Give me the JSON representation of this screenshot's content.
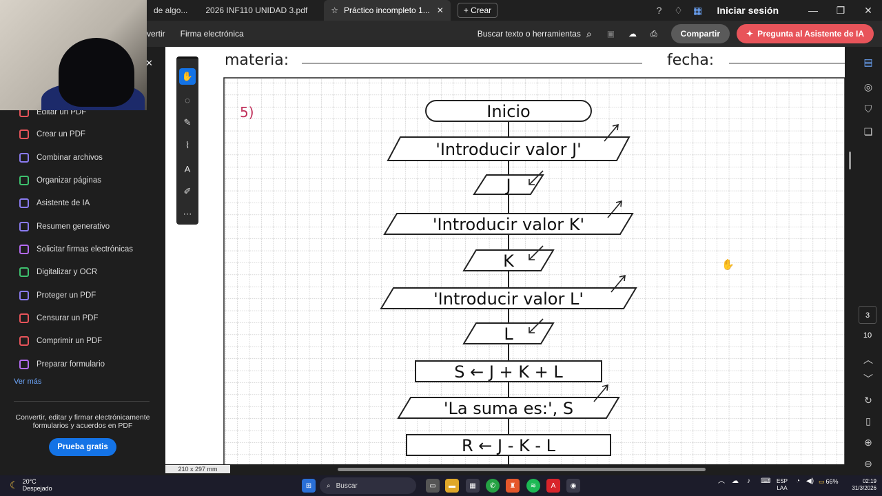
{
  "tabs": [
    {
      "label": "de algo...",
      "active": false
    },
    {
      "label": "2026 INF110 UNIDAD 3.pdf",
      "active": false
    },
    {
      "label": "Práctico incompleto 1...",
      "active": true
    }
  ],
  "new_tab_label": "Crear",
  "login_label": "Iniciar sesión",
  "toolbar": {
    "convert": "vertir",
    "esign": "Firma electrónica",
    "search_tools": "Buscar texto o herramientas",
    "share": "Compartir",
    "ai_ask": "Pregunta al Asistente de IA"
  },
  "sidebar": {
    "items": [
      {
        "label": "Editar un PDF",
        "color": "#e8545a"
      },
      {
        "label": "Crear un PDF",
        "color": "#e8545a"
      },
      {
        "label": "Combinar archivos",
        "color": "#8a7bf0"
      },
      {
        "label": "Organizar páginas",
        "color": "#3ec16e"
      },
      {
        "label": "Asistente de IA",
        "color": "#8a7bf0"
      },
      {
        "label": "Resumen generativo",
        "color": "#8a7bf0"
      },
      {
        "label": "Solicitar firmas electrónicas",
        "color": "#b36af0"
      },
      {
        "label": "Digitalizar y OCR",
        "color": "#3ec16e"
      },
      {
        "label": "Proteger un PDF",
        "color": "#8a7bf0"
      },
      {
        "label": "Censurar un PDF",
        "color": "#e8545a"
      },
      {
        "label": "Comprimir un PDF",
        "color": "#e8545a"
      },
      {
        "label": "Preparar formulario",
        "color": "#b36af0"
      }
    ],
    "see_more": "Ver más",
    "promo": "Convertir, editar y firmar electrónicamente formularios y acuerdos en PDF",
    "trial_button": "Prueba gratis"
  },
  "page_indicator": {
    "current": "3",
    "total": "10"
  },
  "page_size_label": "210 x 297 mm",
  "document": {
    "materia_label": "materia:",
    "fecha_label": "fecha:",
    "exercise_number": "5)",
    "flowchart": [
      {
        "shape": "terminal",
        "text": "Inicio"
      },
      {
        "shape": "output",
        "text": "'Introducir valor J'"
      },
      {
        "shape": "input",
        "text": "J"
      },
      {
        "shape": "output",
        "text": "'Introducir valor K'"
      },
      {
        "shape": "input",
        "text": "K"
      },
      {
        "shape": "output",
        "text": "'Introducir valor L'"
      },
      {
        "shape": "input",
        "text": "L"
      },
      {
        "shape": "process",
        "text": "S ← J + K + L"
      },
      {
        "shape": "output",
        "text": "'La suma es:', S"
      },
      {
        "shape": "process",
        "text": "R ← J - K - L"
      }
    ]
  },
  "taskbar": {
    "temperature": "20°C",
    "condition": "Despejado",
    "search": "Buscar",
    "lang": "ESP",
    "lang_sub": "LAA",
    "battery": "66%",
    "time": "02:19",
    "date": "31/3/2026"
  }
}
